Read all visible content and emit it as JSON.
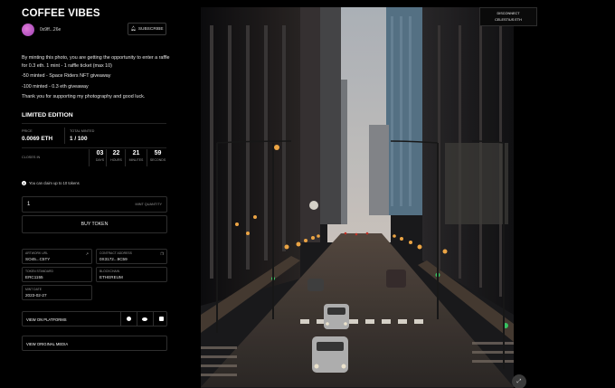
{
  "app": {
    "title": "COFFEE VIBES"
  },
  "creator": {
    "address": "0x9ff...26e"
  },
  "subscribe": {
    "label": "SUBSCRIBE",
    "icon": "bell-icon"
  },
  "description": [
    "By minting this photo, you are getting the opportunity to enter a raffle for 0.3 eth. 1 mint - 1 raffle ticket (max 10)",
    "-50 minted - Space Riders NFT giveaway",
    "-100 minted - 0.3 eth giveaway",
    "Thank you for supporting my photography and good luck."
  ],
  "edition": {
    "heading": "LIMITED EDITION",
    "price_label": "PRICE",
    "price_value": "0.0069 ETH",
    "minted_label": "TOTAL MINTED",
    "minted_value": "1 / 100"
  },
  "countdown": {
    "label": "CLOSES IN",
    "days": "03",
    "days_label": "DAYS",
    "hours": "22",
    "hours_label": "HOURS",
    "minutes": "21",
    "minutes_label": "MINUTES",
    "seconds": "59",
    "seconds_label": "SECONDS"
  },
  "claim_note": "You can claim up to 10 tokens",
  "quantity": {
    "value": "1",
    "label": "MINT QUANTITY"
  },
  "buy_label": "BUY TOKEN",
  "details": {
    "artwork_label": "ARTWORK URL",
    "artwork_value": "SO45...C5TY",
    "contract_label": "CONTRACT ADDRESS",
    "contract_value": "0X3172...9C59",
    "standard_label": "TOKEN STANDARD",
    "standard_value": "ERC1155",
    "blockchain_label": "BLOCKCHAIN",
    "blockchain_value": "ETHEREUM",
    "date_label": "MINT DATE",
    "date_value": "2023-02-27"
  },
  "view_platforms": "VIEW ON PLATFORMS",
  "view_original": "VIEW ORIGINAL MEDIA",
  "wallet": {
    "line1": "DISCONNECT",
    "line2": "CELESTIUS ETH"
  },
  "colors": {
    "background": "#000000",
    "border": "#2e2e2e",
    "accent_avatar": "#c25cc8"
  }
}
